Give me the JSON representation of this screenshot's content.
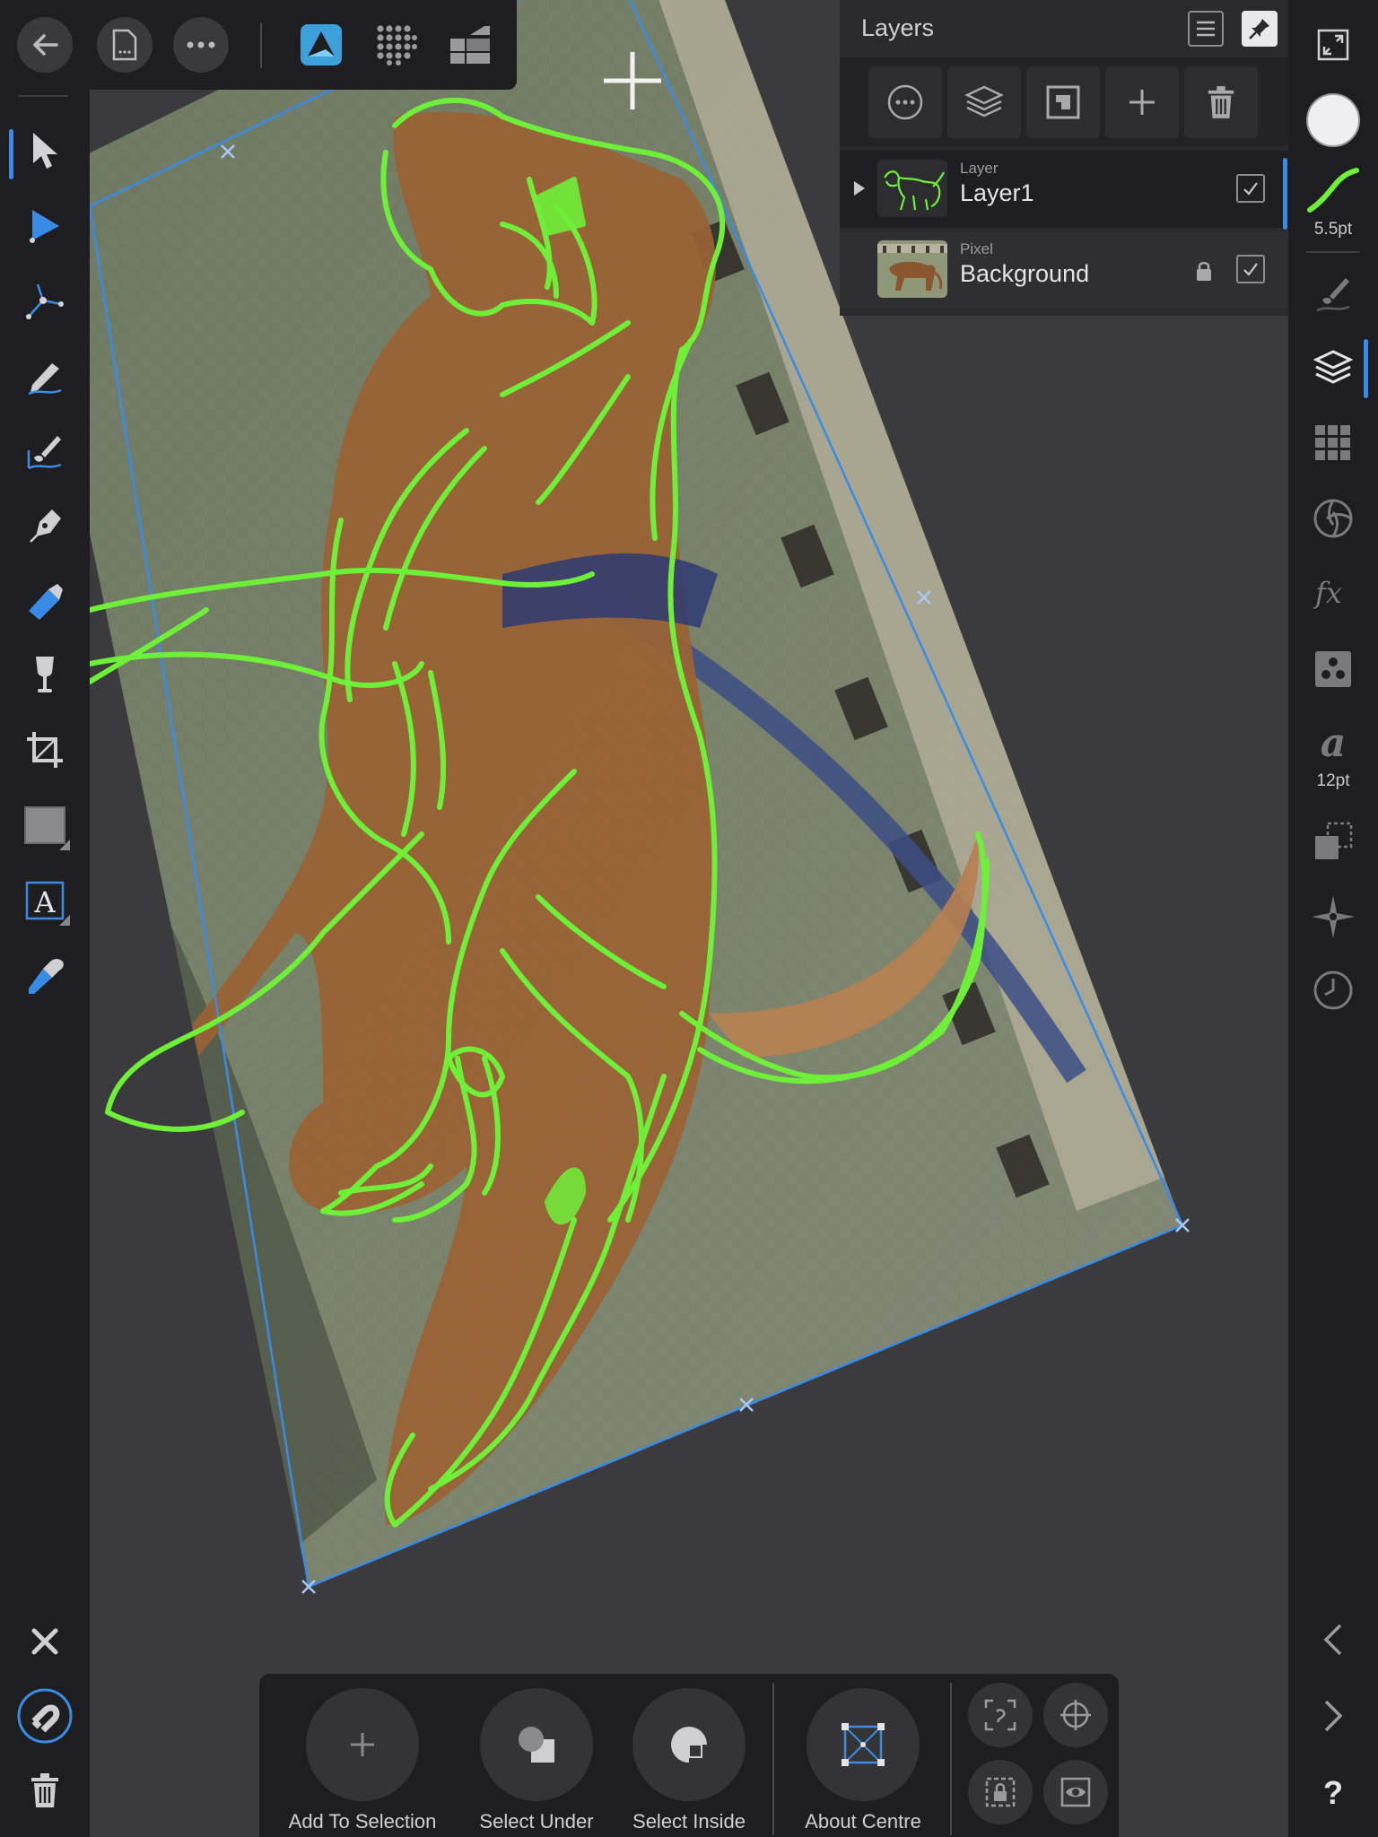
{
  "layers_panel": {
    "title": "Layers",
    "layers": [
      {
        "type": "Layer",
        "name": "Layer1",
        "visible": true,
        "expandable": true,
        "selected": true
      },
      {
        "type": "Pixel",
        "name": "Background",
        "visible": true,
        "locked": true,
        "selected": false
      }
    ]
  },
  "right_toolbar": {
    "brush_size": "5.5pt",
    "font_size": "12pt"
  },
  "bottom_toolbar": {
    "add_to_selection": "Add To Selection",
    "select_under": "Select Under",
    "select_inside": "Select Inside",
    "about_centre": "About Centre"
  },
  "colors": {
    "accent": "#3a8be6",
    "sketch": "#6ef039",
    "panel": "#1e1e20"
  }
}
